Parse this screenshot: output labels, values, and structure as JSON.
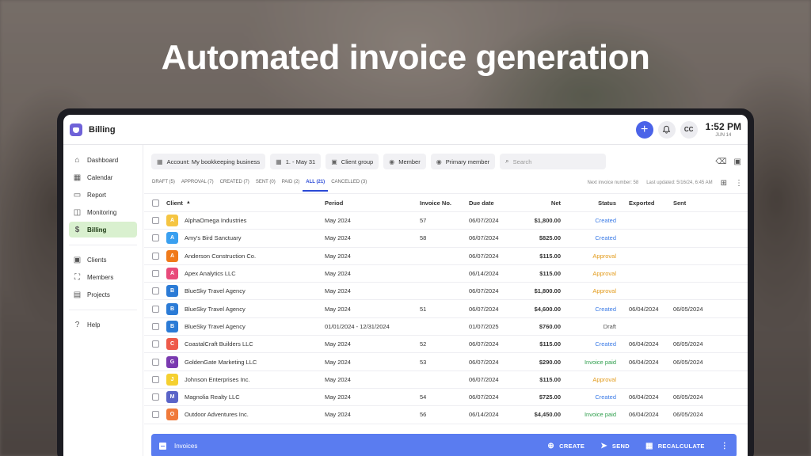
{
  "headline": "Automated invoice generation",
  "app": {
    "title": "Billing"
  },
  "topbar": {
    "add": "+",
    "bell": "🔔",
    "avatar": "CC",
    "time": "1:52 PM",
    "date": "JUN 14"
  },
  "sidebar": {
    "items": [
      {
        "label": "Dashboard",
        "icon": "home-icon",
        "glyph": "⌂"
      },
      {
        "label": "Calendar",
        "icon": "calendar-icon",
        "glyph": "▦"
      },
      {
        "label": "Report",
        "icon": "report-icon",
        "glyph": "▭"
      },
      {
        "label": "Monitoring",
        "icon": "monitoring-icon",
        "glyph": "◫"
      },
      {
        "label": "Billing",
        "icon": "dollar-icon",
        "glyph": "$",
        "active": true
      },
      {
        "label": "Clients",
        "icon": "clients-icon",
        "glyph": "▣"
      },
      {
        "label": "Members",
        "icon": "members-icon",
        "glyph": "⛶"
      },
      {
        "label": "Projects",
        "icon": "projects-icon",
        "glyph": "▤"
      },
      {
        "label": "Help",
        "icon": "help-icon",
        "glyph": "?"
      }
    ]
  },
  "filters": {
    "account": "Account: My bookkeeping business",
    "date": "1. - May 31",
    "client_group": "Client group",
    "member": "Member",
    "primary_member": "Primary member",
    "search_placeholder": "Search"
  },
  "tabs": [
    {
      "label": "DRAFT (5)"
    },
    {
      "label": "APPROVAL (7)"
    },
    {
      "label": "CREATED (7)"
    },
    {
      "label": "SENT (0)"
    },
    {
      "label": "PAID (2)"
    },
    {
      "label": "ALL (21)",
      "active": true
    },
    {
      "label": "CANCELLED (3)"
    }
  ],
  "tabs_meta": {
    "next_invoice": "Next invoice number: 58",
    "last_updated": "Last updated: 5/16/24, 6:45 AM"
  },
  "table": {
    "headers": {
      "client": "Client",
      "period": "Period",
      "invoice_no": "Invoice No.",
      "due_date": "Due date",
      "net": "Net",
      "status": "Status",
      "exported": "Exported",
      "sent": "Sent"
    },
    "rows": [
      {
        "letter": "A",
        "color": "#f5c542",
        "client": "AlphaOmega Industries",
        "period": "May 2024",
        "inv": "57",
        "due": "06/07/2024",
        "net": "$1,800.00",
        "status": "Created",
        "st": "created",
        "exp": "",
        "sent": ""
      },
      {
        "letter": "A",
        "color": "#3aa0f0",
        "client": "Amy's Bird Sanctuary",
        "period": "May 2024",
        "inv": "58",
        "due": "06/07/2024",
        "net": "$825.00",
        "status": "Created",
        "st": "created",
        "exp": "",
        "sent": ""
      },
      {
        "letter": "A",
        "color": "#f07a1a",
        "client": "Anderson Construction Co.",
        "period": "May 2024",
        "inv": "",
        "due": "06/07/2024",
        "net": "$115.00",
        "status": "Approval",
        "st": "approval",
        "exp": "",
        "sent": ""
      },
      {
        "letter": "A",
        "color": "#e84a7a",
        "client": "Apex Analytics LLC",
        "period": "May 2024",
        "inv": "",
        "due": "06/14/2024",
        "net": "$115.00",
        "status": "Approval",
        "st": "approval",
        "exp": "",
        "sent": ""
      },
      {
        "letter": "B",
        "color": "#2b7bd6",
        "client": "BlueSky Travel Agency",
        "period": "May 2024",
        "inv": "",
        "due": "06/07/2024",
        "net": "$1,800.00",
        "status": "Approval",
        "st": "approval",
        "exp": "",
        "sent": ""
      },
      {
        "letter": "B",
        "color": "#2b7bd6",
        "client": "BlueSky Travel Agency",
        "period": "May 2024",
        "inv": "51",
        "due": "06/07/2024",
        "net": "$4,600.00",
        "status": "Created",
        "st": "created",
        "exp": "06/04/2024",
        "sent": "06/05/2024"
      },
      {
        "letter": "B",
        "color": "#2b7bd6",
        "client": "BlueSky Travel Agency",
        "period": "01/01/2024 - 12/31/2024",
        "inv": "",
        "due": "01/07/2025",
        "net": "$760.00",
        "status": "Draft",
        "st": "draft",
        "exp": "",
        "sent": ""
      },
      {
        "letter": "C",
        "color": "#ee5a4a",
        "client": "CoastalCraft Builders LLC",
        "period": "May 2024",
        "inv": "52",
        "due": "06/07/2024",
        "net": "$115.00",
        "status": "Created",
        "st": "created",
        "exp": "06/04/2024",
        "sent": "06/05/2024"
      },
      {
        "letter": "G",
        "color": "#7a3ab0",
        "client": "GoldenGate Marketing LLC",
        "period": "May 2024",
        "inv": "53",
        "due": "06/07/2024",
        "net": "$290.00",
        "status": "Invoice paid",
        "st": "paid",
        "exp": "06/04/2024",
        "sent": "06/05/2024"
      },
      {
        "letter": "J",
        "color": "#f5d030",
        "client": "Johnson Enterprises Inc.",
        "period": "May 2024",
        "inv": "",
        "due": "06/07/2024",
        "net": "$115.00",
        "status": "Approval",
        "st": "approval",
        "exp": "",
        "sent": ""
      },
      {
        "letter": "M",
        "color": "#5a64c8",
        "client": "Magnolia Realty LLC",
        "period": "May 2024",
        "inv": "54",
        "due": "06/07/2024",
        "net": "$725.00",
        "status": "Created",
        "st": "created",
        "exp": "06/04/2024",
        "sent": "06/05/2024"
      },
      {
        "letter": "O",
        "color": "#f07a3a",
        "client": "Outdoor Adventures Inc.",
        "period": "May 2024",
        "inv": "56",
        "due": "06/14/2024",
        "net": "$4,450.00",
        "status": "Invoice paid",
        "st": "paid",
        "exp": "06/04/2024",
        "sent": "06/05/2024"
      }
    ]
  },
  "actionbar": {
    "label": "Invoices",
    "create": "CREATE",
    "send": "SEND",
    "recalculate": "RECALCULATE"
  }
}
